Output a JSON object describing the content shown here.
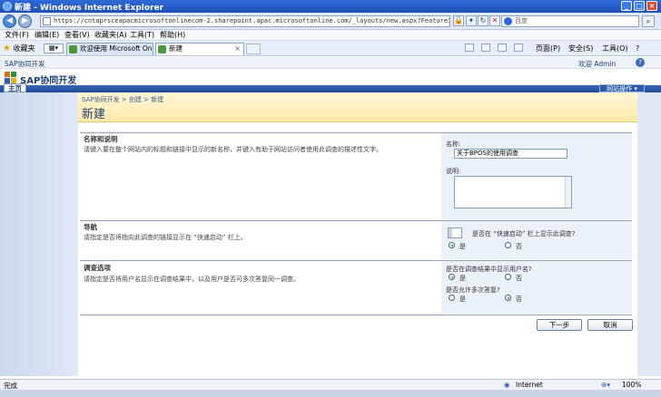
{
  "window": {
    "title": "新建 - Windows Internet Explorer"
  },
  "browser": {
    "url": "https://cntaprsceapacmicrosoftonlinecom-2.sharepoint.apac.microsoftonline.com/_layouts/new.aspx?FeatureId={00bfea71-eb8a-4",
    "search_placeholder": "百度",
    "menu": [
      "文件(F)",
      "编辑(E)",
      "查看(V)",
      "收藏夹(A)",
      "工具(T)",
      "帮助(H)"
    ],
    "favorites_label": "收藏夹",
    "tabs": [
      {
        "label": "欢迎使用 Microsoft Onl..."
      },
      {
        "label": "新建"
      }
    ],
    "commands": {
      "page": "页面(P)",
      "safety": "安全(S)",
      "tools": "工具(O)"
    }
  },
  "sharepoint": {
    "site_label": "SAP协同开发",
    "user_label": "欢迎 Admin",
    "site_name": "SAP协同开发",
    "home_tab": "主页",
    "site_actions": "网站操作"
  },
  "page": {
    "breadcrumb": [
      "SAP协同开发",
      "创建",
      "新建"
    ],
    "breadcrumb_sep": ">",
    "title": "新建"
  },
  "sections": {
    "name": {
      "title": "名称和说明",
      "description": "请键入要在整个网站内的标题和链接中显示的新名称，并键入有助于网站访问者使用此调查的描述性文字。",
      "name_label": "名称:",
      "name_value": "关于BPOS的使用调查",
      "desc_label": "说明:"
    },
    "nav": {
      "title": "导航",
      "description": "请指定是否将指向此调查的链接显示在 “快速启动” 栏上。",
      "question": "是否在 “快速启动” 栏上显示此调查?",
      "yes": "是",
      "no": "否",
      "selected": "yes"
    },
    "options": {
      "title": "调查选项",
      "description": "请指定是否将用户名显示在调查结果中，以及用户是否可多次答复同一调查。",
      "q1": "是否在调查结果中显示用户名?",
      "q1_selected": "yes",
      "q2": "是否允许多次答复?",
      "q2_selected": "no",
      "yes": "是",
      "no": "否"
    }
  },
  "buttons": {
    "next": "下一步",
    "cancel": "取消"
  },
  "status": {
    "left": "完成",
    "zone": "Internet",
    "zoom": "100%"
  },
  "colors": {
    "title_bar": "#1f4fb7",
    "header_yellow": "#fde9a8",
    "nav_blue": "#1f4a97",
    "radio_selected": "#1c9b2a"
  }
}
